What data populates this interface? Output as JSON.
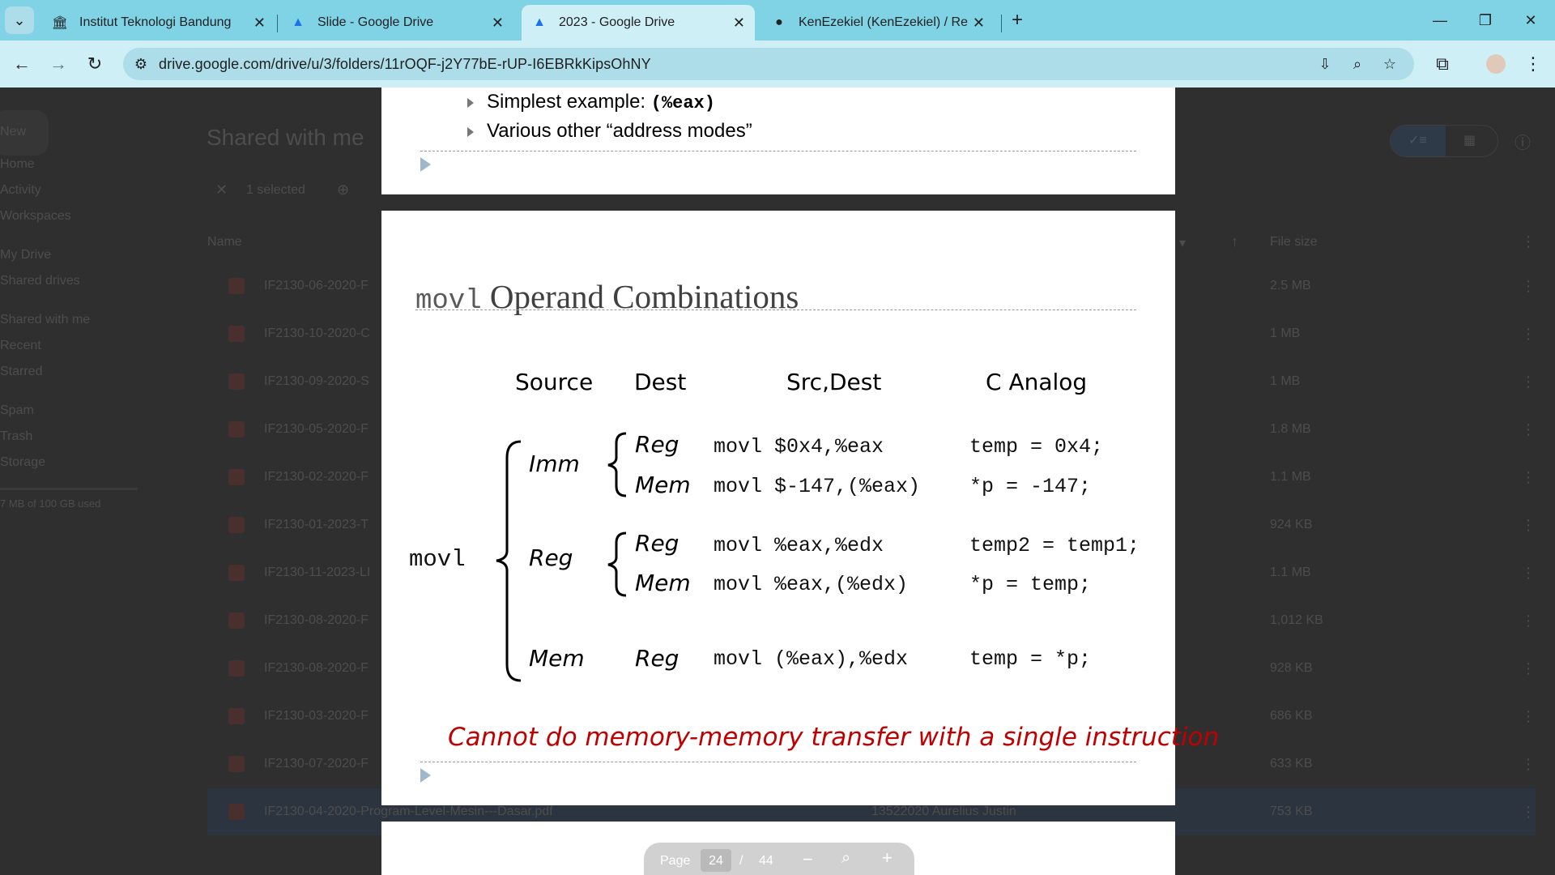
{
  "browser": {
    "tabs": [
      {
        "title": "Institut Teknologi Bandung",
        "icon": "itb-logo-icon"
      },
      {
        "title": "Slide - Google Drive",
        "icon": "google-drive-icon"
      },
      {
        "title": "2023 - Google Drive",
        "icon": "google-drive-icon"
      },
      {
        "title": "KenEzekiel (KenEzekiel) / Repos",
        "icon": "github-icon"
      }
    ],
    "url": "drive.google.com/drive/u/3/folders/11rOQF-j2Y77bE-rUP-I6EBRkKipsOhNY"
  },
  "drive": {
    "new_label": "New",
    "page_title": "Shared with me",
    "selection_label": "1 selected",
    "col_name": "Name",
    "col_size": "File size",
    "sidebar": [
      "Home",
      "Activity",
      "Workspaces",
      "My Drive",
      "Shared drives",
      "Shared with me",
      "Recent",
      "Starred",
      "Spam",
      "Trash",
      "Storage"
    ],
    "storage_text": "7 MB of 100 GB used",
    "rows": [
      {
        "name": "IF2130-06-2020-F",
        "size": "2.5 MB"
      },
      {
        "name": "IF2130-10-2020-C",
        "size": "1 MB"
      },
      {
        "name": "IF2130-09-2020-S",
        "size": "1 MB"
      },
      {
        "name": "IF2130-05-2020-F",
        "size": "1.8 MB"
      },
      {
        "name": "IF2130-02-2020-F",
        "size": "1.1 MB"
      },
      {
        "name": "IF2130-01-2023-T",
        "size": "924 KB"
      },
      {
        "name": "IF2130-11-2023-LI",
        "size": "1.1 MB"
      },
      {
        "name": "IF2130-08-2020-F",
        "size": "1,012 KB"
      },
      {
        "name": "IF2130-08-2020-F",
        "size": "928 KB"
      },
      {
        "name": "IF2130-03-2020-F",
        "size": "686 KB"
      },
      {
        "name": "IF2130-07-2020-F",
        "size": "633 KB"
      },
      {
        "name": "IF2130-04-2020-Program-Level-Mesin---Dasar.pdf",
        "size": "753 KB",
        "owner": "13522020 Aurelius Justin"
      }
    ]
  },
  "slide_prev": {
    "bullet1": "Simplest example: ",
    "bullet1_code": "(%eax)",
    "bullet2": "Various other “address modes”"
  },
  "slide": {
    "title_code": "movl",
    "title_text": " Operand Combinations",
    "headers": {
      "source": "Source",
      "dest": "Dest",
      "srcdest": "Src,Dest",
      "canalog": "C Analog"
    },
    "movl": "movl",
    "src_imm": "Imm",
    "src_reg": "Reg",
    "src_mem": "Mem",
    "rows": [
      {
        "dest": "Reg",
        "code": "movl $0x4,%eax",
        "c": "temp = 0x4;"
      },
      {
        "dest": "Mem",
        "code": "movl $-147,(%eax)",
        "c": "*p = -147;"
      },
      {
        "dest": "Reg",
        "code": "movl %eax,%edx",
        "c": "temp2 = temp1;"
      },
      {
        "dest": "Mem",
        "code": "movl %eax,(%edx)",
        "c": "*p = temp;"
      },
      {
        "dest": "Reg",
        "code": "movl (%eax),%edx",
        "c": "temp = *p;"
      }
    ],
    "warning": "Cannot do memory-memory transfer with a single instruction"
  },
  "pager": {
    "label": "Page",
    "current": "24",
    "sep": "/",
    "total": "44"
  }
}
